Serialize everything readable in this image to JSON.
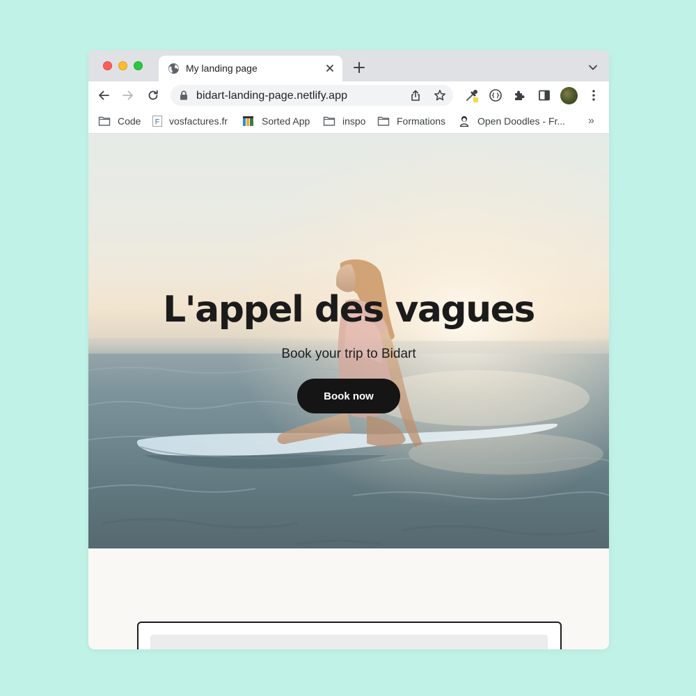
{
  "browser": {
    "tab_title": "My landing page",
    "url": "bidart-landing-page.netlify.app",
    "bookmarks": [
      {
        "label": "Code",
        "icon": "folder-icon"
      },
      {
        "label": "vosfactures.fr",
        "icon": "vosfactures-favicon"
      },
      {
        "label": "Sorted App",
        "icon": "sorted-app-favicon"
      },
      {
        "label": "inspo",
        "icon": "folder-icon"
      },
      {
        "label": "Formations",
        "icon": "folder-icon"
      },
      {
        "label": "Open Doodles - Fr...",
        "icon": "open-doodles-favicon"
      }
    ],
    "bookmarks_more": "»",
    "favicon_letter": "F"
  },
  "hero": {
    "title": "L'appel des vagues",
    "subtitle": "Book your trip to Bidart",
    "cta_label": "Book now"
  },
  "colors": {
    "page_background": "#c1f2e8",
    "cta_background": "#151515",
    "hero_text": "#1b1b1b"
  }
}
